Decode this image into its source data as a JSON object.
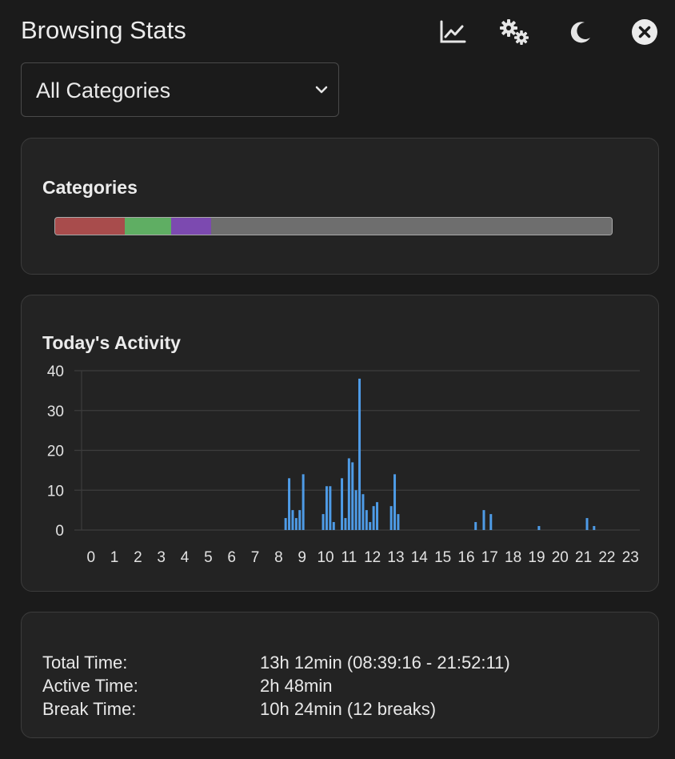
{
  "header": {
    "title": "Browsing Stats",
    "icons": [
      "chart-line-icon",
      "gears-icon",
      "moon-icon",
      "close-icon"
    ]
  },
  "category_select": {
    "selected": "All Categories"
  },
  "categories_card": {
    "title": "Categories",
    "segments": [
      {
        "color": "#a84c4c",
        "fraction": 0.125
      },
      {
        "color": "#5fae63",
        "fraction": 0.083
      },
      {
        "color": "#7c4ab0",
        "fraction": 0.072
      },
      {
        "color": "#6e6e6e",
        "fraction": 0.72
      }
    ]
  },
  "activity_card": {
    "title": "Today's Activity",
    "chart_data": {
      "type": "bar",
      "title": "Today's Activity",
      "xlabel": "",
      "ylabel": "",
      "ylim": [
        0,
        40
      ],
      "yticks": [
        "0",
        "10",
        "20",
        "30",
        "40"
      ],
      "xlim": [
        -0.4,
        23.4
      ],
      "xticks": [
        "0",
        "1",
        "2",
        "3",
        "4",
        "5",
        "6",
        "7",
        "8",
        "9",
        "10",
        "11",
        "12",
        "13",
        "14",
        "15",
        "16",
        "17",
        "18",
        "19",
        "20",
        "21",
        "22",
        "23"
      ],
      "grid": true,
      "bar_color": "#4e9be6",
      "points": [
        {
          "x": 8.3,
          "y": 3
        },
        {
          "x": 8.45,
          "y": 13
        },
        {
          "x": 8.6,
          "y": 5
        },
        {
          "x": 8.75,
          "y": 3
        },
        {
          "x": 8.9,
          "y": 5
        },
        {
          "x": 9.05,
          "y": 14
        },
        {
          "x": 9.9,
          "y": 4
        },
        {
          "x": 10.05,
          "y": 11
        },
        {
          "x": 10.2,
          "y": 11
        },
        {
          "x": 10.35,
          "y": 2
        },
        {
          "x": 10.7,
          "y": 13
        },
        {
          "x": 10.85,
          "y": 3
        },
        {
          "x": 11.0,
          "y": 18
        },
        {
          "x": 11.15,
          "y": 17
        },
        {
          "x": 11.3,
          "y": 10
        },
        {
          "x": 11.45,
          "y": 38
        },
        {
          "x": 11.6,
          "y": 9
        },
        {
          "x": 11.75,
          "y": 5
        },
        {
          "x": 11.9,
          "y": 2
        },
        {
          "x": 12.05,
          "y": 6
        },
        {
          "x": 12.2,
          "y": 7
        },
        {
          "x": 12.8,
          "y": 6
        },
        {
          "x": 12.95,
          "y": 14
        },
        {
          "x": 13.1,
          "y": 4
        },
        {
          "x": 16.4,
          "y": 2
        },
        {
          "x": 16.75,
          "y": 5
        },
        {
          "x": 17.05,
          "y": 4
        },
        {
          "x": 19.1,
          "y": 1
        },
        {
          "x": 21.15,
          "y": 3
        },
        {
          "x": 21.45,
          "y": 1
        }
      ]
    }
  },
  "summary_card": {
    "rows": [
      {
        "label": "Total Time:",
        "value": "13h 12min (08:39:16 - 21:52:11)"
      },
      {
        "label": "Active Time:",
        "value": "2h 48min"
      },
      {
        "label": "Break Time:",
        "value": "10h 24min (12 breaks)"
      }
    ]
  }
}
